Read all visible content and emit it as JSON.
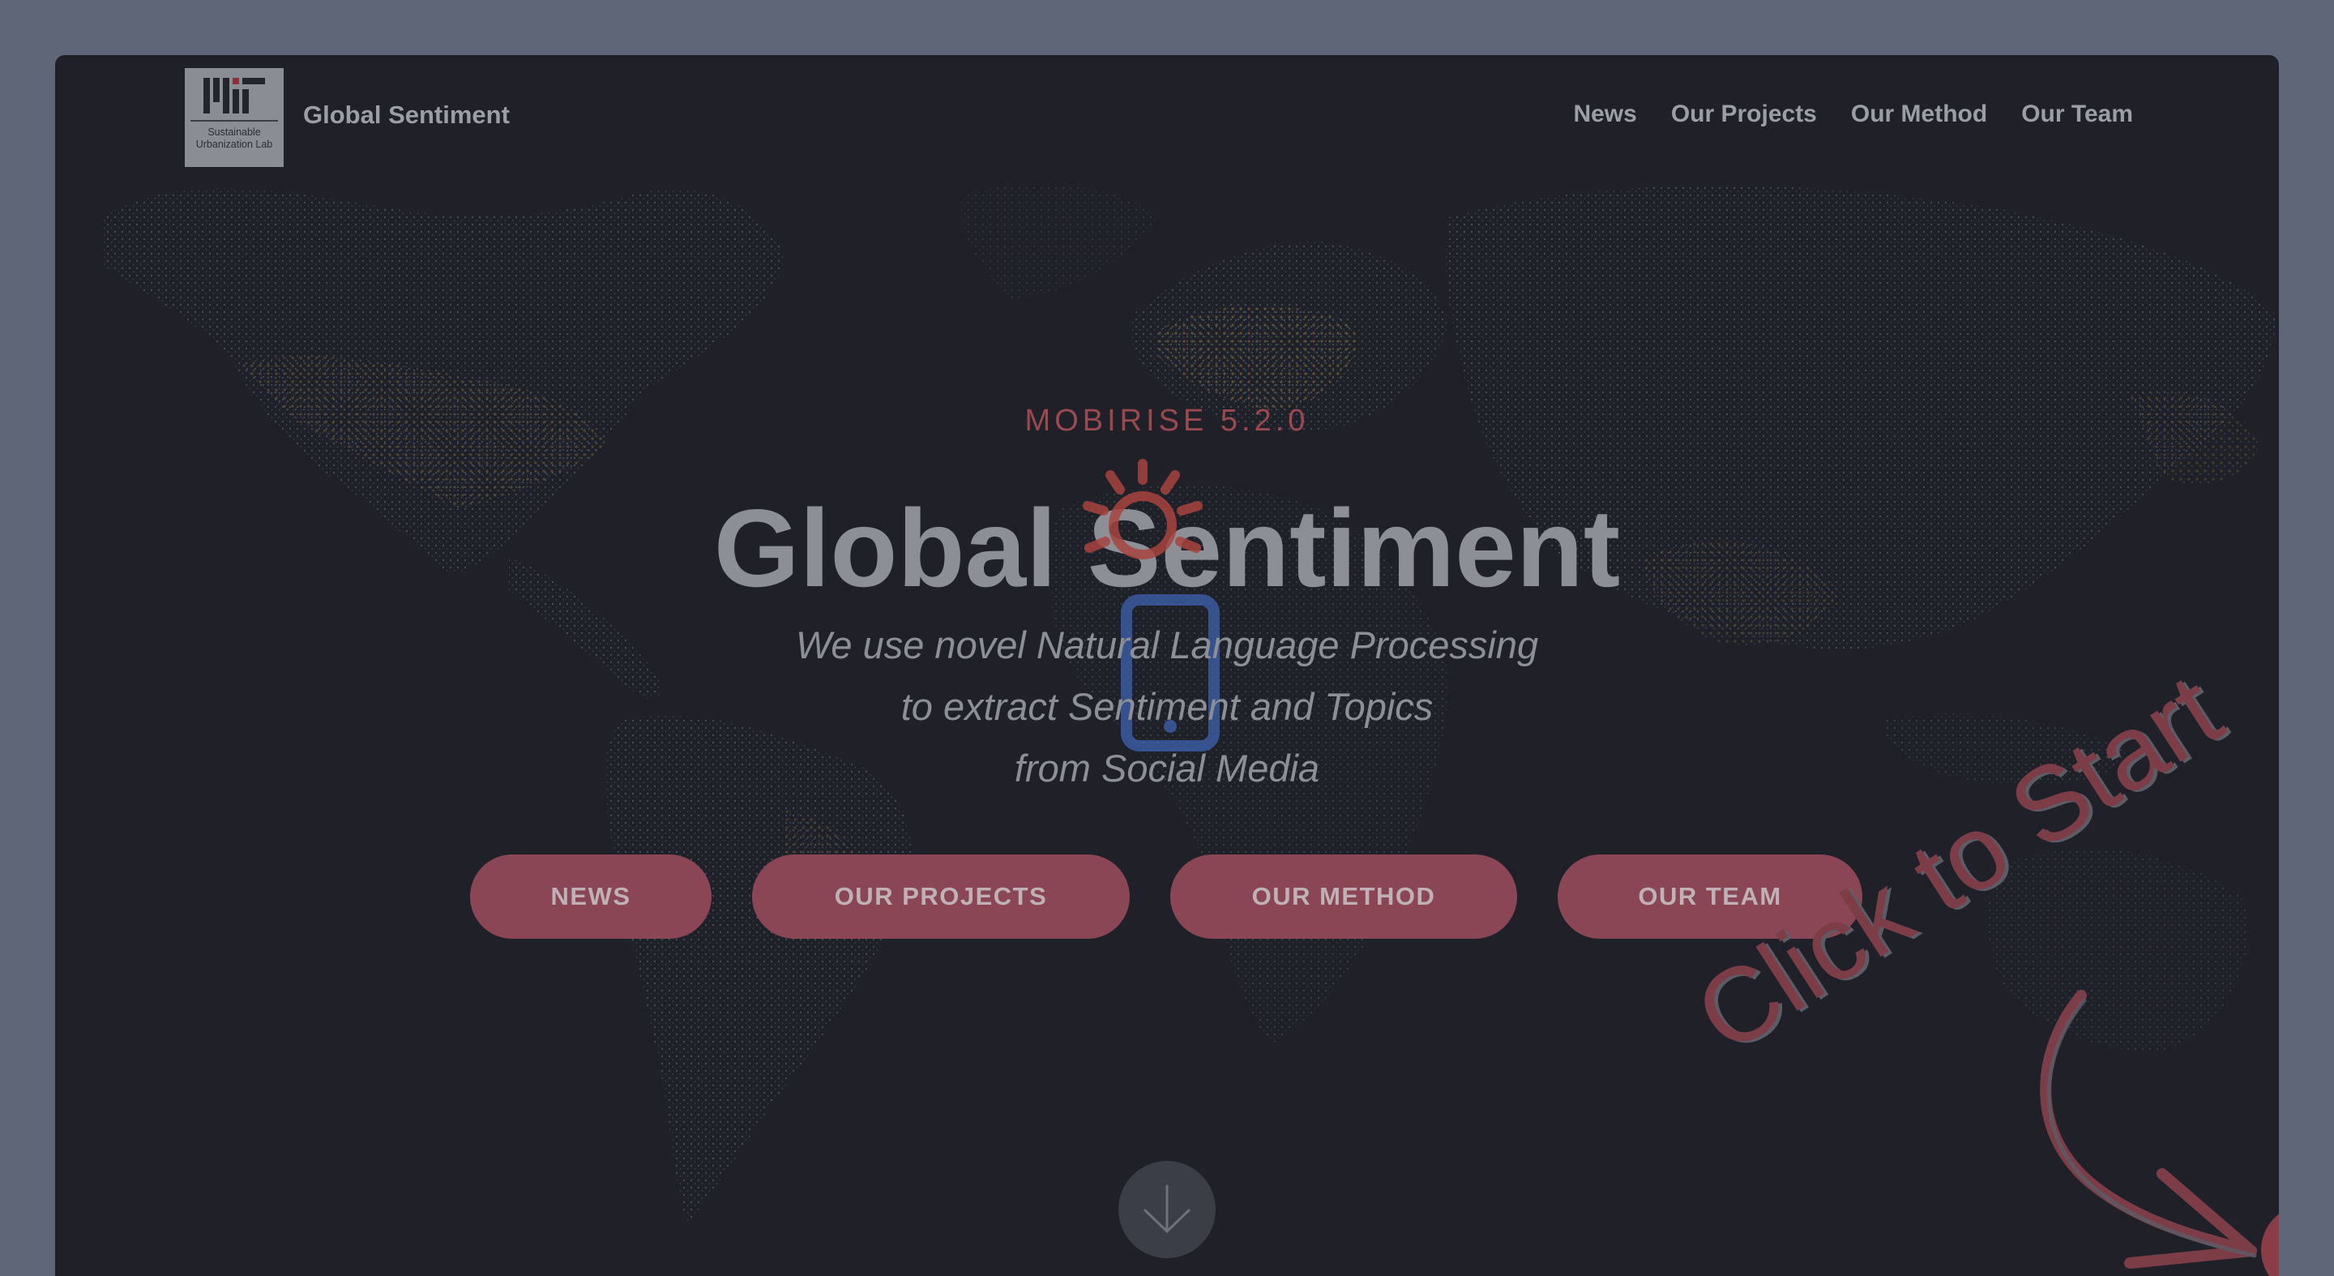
{
  "brand": {
    "logo_text": "MIT",
    "logo_subtitle": [
      "Sustainable",
      "Urbanization Lab"
    ],
    "name": "Global Sentiment"
  },
  "nav": {
    "items": [
      {
        "label": "News"
      },
      {
        "label": "Our Projects"
      },
      {
        "label": "Our Method"
      },
      {
        "label": "Our Team"
      }
    ]
  },
  "hero": {
    "badge": "MOBIRISE  5.2.0",
    "title": "Global Sentiment",
    "lines": [
      "We use novel Natural Language Processing",
      "to extract Sentiment and Topics",
      "from Social Media"
    ],
    "buttons": [
      {
        "label": "NEWS"
      },
      {
        "label": "OUR PROJECTS"
      },
      {
        "label": "OUR METHOD"
      },
      {
        "label": "OUR TEAM"
      }
    ]
  },
  "overlay": {
    "click_to_start": "Click to Start"
  },
  "icons": {
    "sun": "sun-icon",
    "phone": "mobile-phone-icon",
    "down": "arrow-down-icon",
    "plus": "plus-icon"
  },
  "colors": {
    "page_bg": "#5f6677",
    "frame_bg": "#1f2129",
    "accent": "#8a4655",
    "badge": "#9b4950",
    "phone_blue": "#3d5fa8",
    "sun_red": "#a8443f"
  }
}
